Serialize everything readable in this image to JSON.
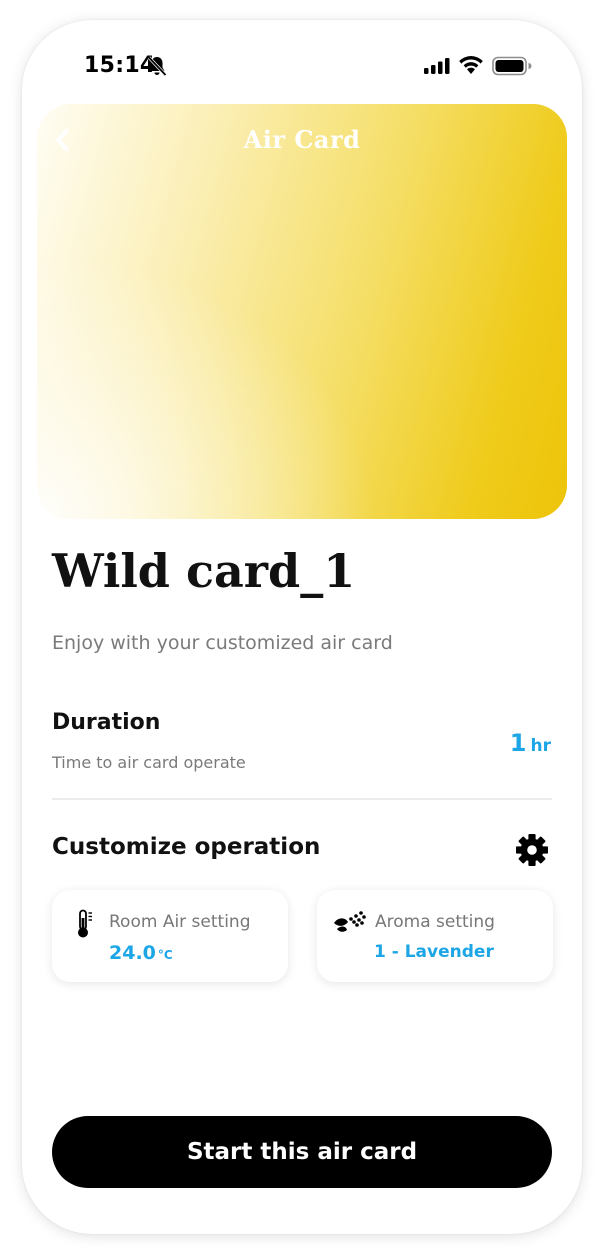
{
  "status_bar": {
    "time": "15:14",
    "icons": [
      "bell-slash-icon",
      "signal-icon",
      "wifi-icon",
      "battery-icon"
    ]
  },
  "header": {
    "title": "Air Card",
    "back_icon": "chevron-left-icon"
  },
  "card": {
    "name": "Wild card_1",
    "subtitle": "Enjoy with your customized air card"
  },
  "duration": {
    "title": "Duration",
    "description": "Time to air card operate",
    "value": "1",
    "unit": "hr"
  },
  "customize": {
    "title": "Customize operation",
    "settings_icon": "gear-icon"
  },
  "settings": {
    "room": {
      "label": "Room Air setting",
      "value": "24.0",
      "unit": "°C",
      "icon": "thermometer-icon"
    },
    "aroma": {
      "label": "Aroma setting",
      "value": "1 - Lavender",
      "icon": "aroma-icon"
    }
  },
  "actions": {
    "start_label": "Start this air card"
  },
  "colors": {
    "accent": "#1CA6E6",
    "gradient_start": "#FFFDF4",
    "gradient_end": "#EDC409",
    "button_bg": "#000000"
  }
}
